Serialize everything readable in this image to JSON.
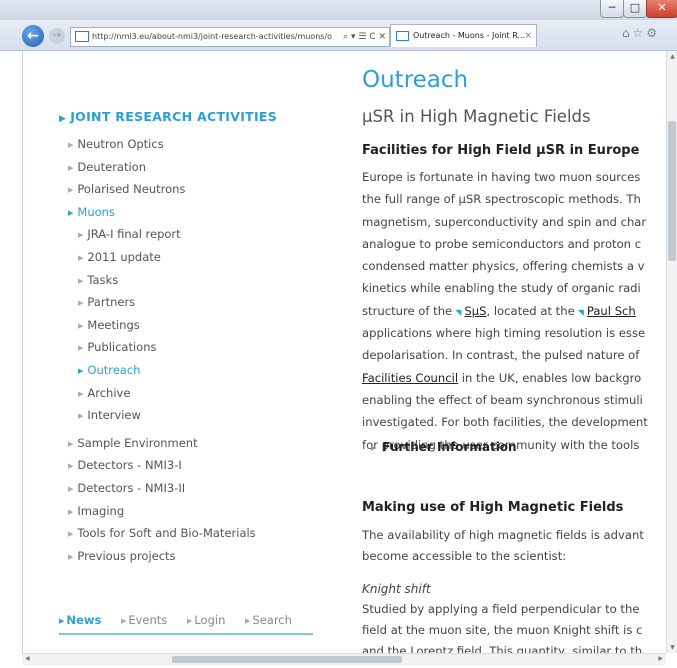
{
  "browser": {
    "url": "http://nmi3.eu/about-nmi3/joint-research-activities/muons/o",
    "address_tools": "⌕ ▾ ☰ C ✕",
    "tab_title": "Outreach - Muons - Joint R...",
    "tab_close": "×",
    "window_min": "─",
    "window_max": "□",
    "window_close": "✕",
    "back_glyph": "←",
    "forward_glyph": "→",
    "right_icons": "⌂☆⚙"
  },
  "sidebar": {
    "section_title": "JOINT RESEARCH ACTIVITIES",
    "items": [
      {
        "label": "Neutron Optics"
      },
      {
        "label": "Deuteration"
      },
      {
        "label": "Polarised Neutrons"
      },
      {
        "label": "Muons"
      },
      {
        "label": "JRA-I final report"
      },
      {
        "label": "2011 update"
      },
      {
        "label": "Tasks"
      },
      {
        "label": "Partners"
      },
      {
        "label": "Meetings"
      },
      {
        "label": "Publications"
      },
      {
        "label": "Outreach"
      },
      {
        "label": "Archive"
      },
      {
        "label": "Interview"
      },
      {
        "label": "Sample Environment"
      },
      {
        "label": "Detectors - NMI3-I"
      },
      {
        "label": "Detectors - NMI3-II"
      },
      {
        "label": "Imaging"
      },
      {
        "label": "Tools for Soft and Bio-Materials"
      },
      {
        "label": "Previous projects"
      }
    ],
    "footer_links": [
      "News",
      "Events",
      "Login",
      "Search"
    ]
  },
  "content": {
    "title": "Outreach",
    "subtitle": "µSR in High Magnetic Fields",
    "section1_heading": "Facilities for High Field µSR in Europe",
    "para1": [
      "Europe is fortunate in having two muon sources",
      "the full range of µSR spectroscopic methods. Th",
      "magnetism, superconductivity and spin and char",
      "analogue to probe semiconductors and proton c",
      "condensed matter physics, offering chemists a v",
      "kinetics while enabling the study of organic radi"
    ],
    "para1_line7_pre": "structure of the",
    "para1_link1": "SµS",
    "para1_line7_mid": ", located at the",
    "para1_link2": "Paul Sch",
    "para1_line8": "applications where high timing resolution is esse",
    "para1_line9": "depolarisation. In contrast, the pulsed nature of",
    "para1_link3": "Facilities Council",
    "para1_line10_post": " in the UK, enables low backgro",
    "para1_rest": [
      "enabling the effect of beam synchronous stimuli",
      "investigated. For both facilities, the development",
      "for providing the user community with the tools"
    ],
    "further_info": "Further Information",
    "section2_heading": "Making use of High Magnetic Fields",
    "para2": [
      "The availability of high magnetic fields is advant",
      "become accessible to the scientist:"
    ],
    "knight_heading": "Knight shift",
    "para3": [
      "Studied by applying a field perpendicular to the",
      "field at the muon site, the muon Knight shift is c",
      "and the Lorentz field. This quantity, similar to th"
    ]
  },
  "colors": {
    "accent": "#2d9fd3",
    "text": "#444444",
    "heading": "#222222"
  }
}
